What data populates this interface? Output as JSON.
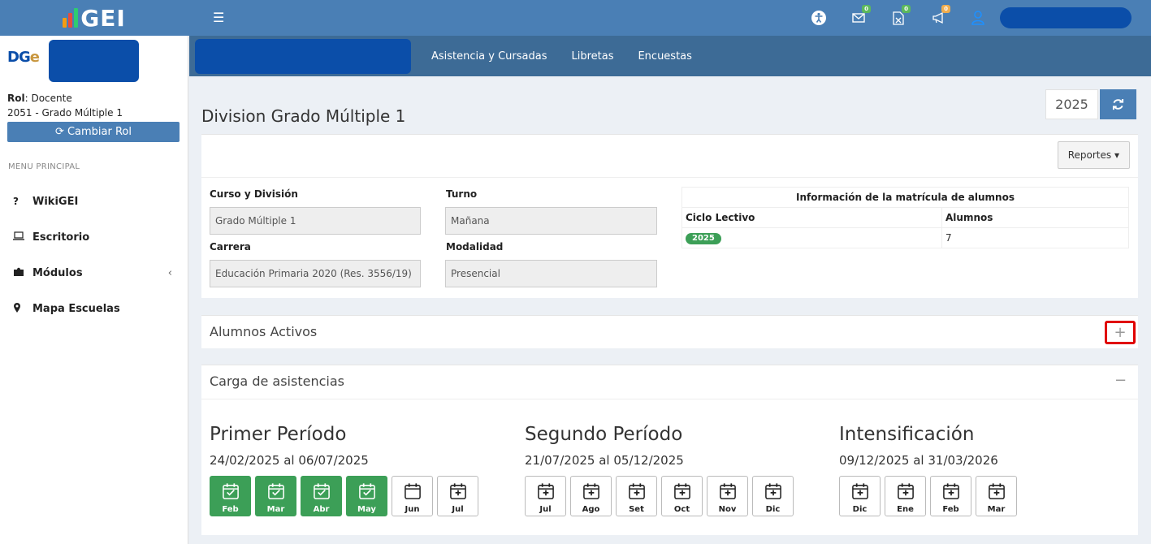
{
  "brand": {
    "name": "GEI"
  },
  "header": {
    "icons": [
      {
        "name": "accessibility-icon",
        "badge": ""
      },
      {
        "name": "mail-icon",
        "badge": "0"
      },
      {
        "name": "excel-file-icon",
        "badge": "0"
      },
      {
        "name": "megaphone-icon",
        "badge": "0"
      },
      {
        "name": "user-icon",
        "badge": ""
      }
    ]
  },
  "sidebar": {
    "logo": "DGE",
    "rol_label": "Rol",
    "rol_value": ": Docente",
    "division": "2051 - Grado Múltiple 1",
    "change_role": "Cambiar Rol",
    "menu_header": "MENU PRINCIPAL",
    "items": [
      {
        "label": "WikiGEI",
        "icon": "question-icon"
      },
      {
        "label": "Escritorio",
        "icon": "laptop-icon"
      },
      {
        "label": "Módulos",
        "icon": "puzzle-icon",
        "chevron": "‹"
      },
      {
        "label": "Mapa Escuelas",
        "icon": "map-marker-icon"
      }
    ]
  },
  "subnav": {
    "links": [
      "Asistencia y Cursadas",
      "Libretas",
      "Encuestas"
    ]
  },
  "page": {
    "title": "Division Grado Múltiple 1",
    "year": "2025",
    "reportes": "Reportes ▾"
  },
  "info": {
    "curso_label": "Curso y División",
    "curso_value": "Grado Múltiple 1",
    "turno_label": "Turno",
    "turno_value": "Mañana",
    "carrera_label": "Carrera",
    "carrera_value": "Educación Primaria 2020 (Res. 3556/19)",
    "modalidad_label": "Modalidad",
    "modalidad_value": "Presencial"
  },
  "matricula": {
    "title": "Información de la matrícula de alumnos",
    "col1": "Ciclo Lectivo",
    "col2": "Alumnos",
    "ciclo": "2025",
    "alumnos": "7"
  },
  "alumnos_activos": {
    "title": "Alumnos Activos",
    "toggle": "+"
  },
  "asistencias": {
    "title": "Carga de asistencias",
    "toggle": "−",
    "periods": [
      {
        "title": "Primer Período",
        "range": "24/02/2025 al 06/07/2025",
        "months": [
          {
            "label": "Feb",
            "state": "done"
          },
          {
            "label": "Mar",
            "state": "done"
          },
          {
            "label": "Abr",
            "state": "done"
          },
          {
            "label": "May",
            "state": "done"
          },
          {
            "label": "Jun",
            "state": "empty"
          },
          {
            "label": "Jul",
            "state": "add"
          }
        ]
      },
      {
        "title": "Segundo Período",
        "range": "21/07/2025 al 05/12/2025",
        "months": [
          {
            "label": "Jul",
            "state": "add"
          },
          {
            "label": "Ago",
            "state": "add"
          },
          {
            "label": "Set",
            "state": "add"
          },
          {
            "label": "Oct",
            "state": "add"
          },
          {
            "label": "Nov",
            "state": "add"
          },
          {
            "label": "Dic",
            "state": "add"
          }
        ]
      },
      {
        "title": "Intensificación",
        "range": "09/12/2025 al 31/03/2026",
        "months": [
          {
            "label": "Dic",
            "state": "add"
          },
          {
            "label": "Ene",
            "state": "add"
          },
          {
            "label": "Feb",
            "state": "add"
          },
          {
            "label": "Mar",
            "state": "add"
          }
        ]
      }
    ]
  },
  "colors": {
    "header": "#4a7fb5",
    "subnav": "#3d6b96",
    "redacted": "#0b4ea9",
    "success": "#3c9f57",
    "highlight": "#e00000"
  }
}
